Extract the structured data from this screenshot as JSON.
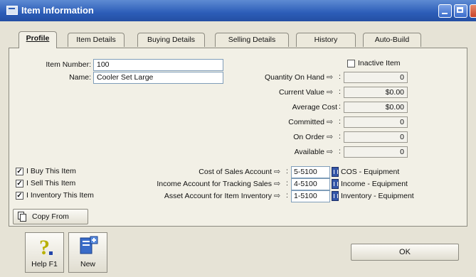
{
  "window": {
    "title": "Item Information",
    "controls": [
      "minimize",
      "maximize",
      "close"
    ]
  },
  "tabs": [
    {
      "label": "Profile",
      "active": true
    },
    {
      "label": "Item Details",
      "active": false
    },
    {
      "label": "Buying Details",
      "active": false
    },
    {
      "label": "Selling Details",
      "active": false
    },
    {
      "label": "History",
      "active": false
    },
    {
      "label": "Auto-Build",
      "active": false
    }
  ],
  "profile": {
    "item_number_label": "Item Number:",
    "item_number_value": "100",
    "name_label": "Name:",
    "name_value": "Cooler Set Large",
    "inactive_label": "Inactive Item",
    "inactive_checked": false,
    "stats": [
      {
        "label": "Quantity On Hand",
        "value": "0",
        "has_arrow": true
      },
      {
        "label": "Current Value",
        "value": "$0.00",
        "has_arrow": true
      },
      {
        "label": "Average Cost",
        "value": "$0.00",
        "has_arrow": false
      },
      {
        "label": "Committed",
        "value": "0",
        "has_arrow": true
      },
      {
        "label": "On Order",
        "value": "0",
        "has_arrow": true
      },
      {
        "label": "Available",
        "value": "0",
        "has_arrow": true
      }
    ],
    "checkboxes": [
      {
        "label": "I Buy This Item",
        "checked": true
      },
      {
        "label": "I Sell This Item",
        "checked": true
      },
      {
        "label": "I Inventory This Item",
        "checked": true
      }
    ],
    "accounts": [
      {
        "label": "Cost of Sales Account",
        "number": "5-5100",
        "name": "COS - Equipment"
      },
      {
        "label": "Income Account for Tracking Sales",
        "number": "4-5100",
        "name": "Income - Equipment"
      },
      {
        "label": "Asset Account for Item Inventory",
        "number": "1-5100",
        "name": "Inventory - Equipment"
      }
    ],
    "copy_from_label": "Copy From"
  },
  "footer": {
    "help_label": "Help F1",
    "new_label": "New",
    "ok_label": "OK"
  },
  "colors": {
    "title_bar": "#2c5db8",
    "background": "#e6e3d6",
    "list_button": "#3456a8"
  }
}
